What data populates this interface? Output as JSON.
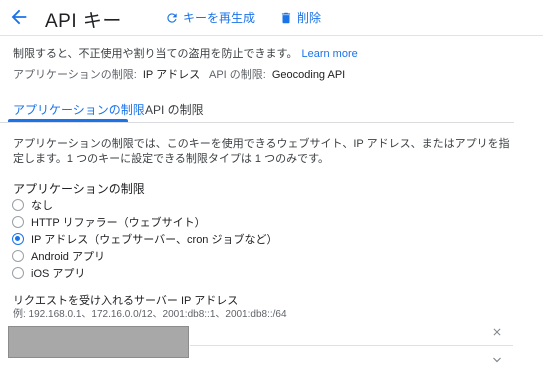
{
  "header": {
    "title": "API キー",
    "regenerate_label": "キーを再生成",
    "delete_label": "削除",
    "accent_color": "#1a73e8"
  },
  "notice": {
    "text": "制限すると、不正使用や割り当ての盗用を防止できます。",
    "link": "Learn more"
  },
  "restrictions_summary": {
    "app_label": "アプリケーションの制限:",
    "app_value": "IP アドレス",
    "api_label": "API の制限:",
    "api_value": "Geocoding API"
  },
  "tabs": [
    {
      "label": "アプリケーションの制限",
      "active": true
    },
    {
      "label": "API の制限",
      "active": false
    }
  ],
  "description": "アプリケーションの制限では、このキーを使用できるウェブサイト、IP アドレス、またはアプリを指定します。1 つのキーに設定できる制限タイプは 1 つのみです。",
  "app_restriction": {
    "title": "アプリケーションの制限",
    "options": [
      {
        "label": "なし",
        "checked": false
      },
      {
        "label": "HTTP リファラー（ウェブサイト）",
        "checked": false
      },
      {
        "label": "IP アドレス（ウェブサーバー、cron ジョブなど）",
        "checked": true
      },
      {
        "label": "Android アプリ",
        "checked": false
      },
      {
        "label": "iOS アプリ",
        "checked": false
      }
    ]
  },
  "ip_section": {
    "label": "リクエストを受け入れるサーバー IP アドレス",
    "example": "例: 192.168.0.1、172.16.0.0/12、2001:db8::1、2001:db8::/64",
    "input_value": ""
  },
  "icons": {
    "back": "arrow-back-icon",
    "regenerate": "refresh-icon",
    "delete": "trash-icon",
    "clear": "close-icon",
    "chevron": "chevron-down-icon"
  }
}
